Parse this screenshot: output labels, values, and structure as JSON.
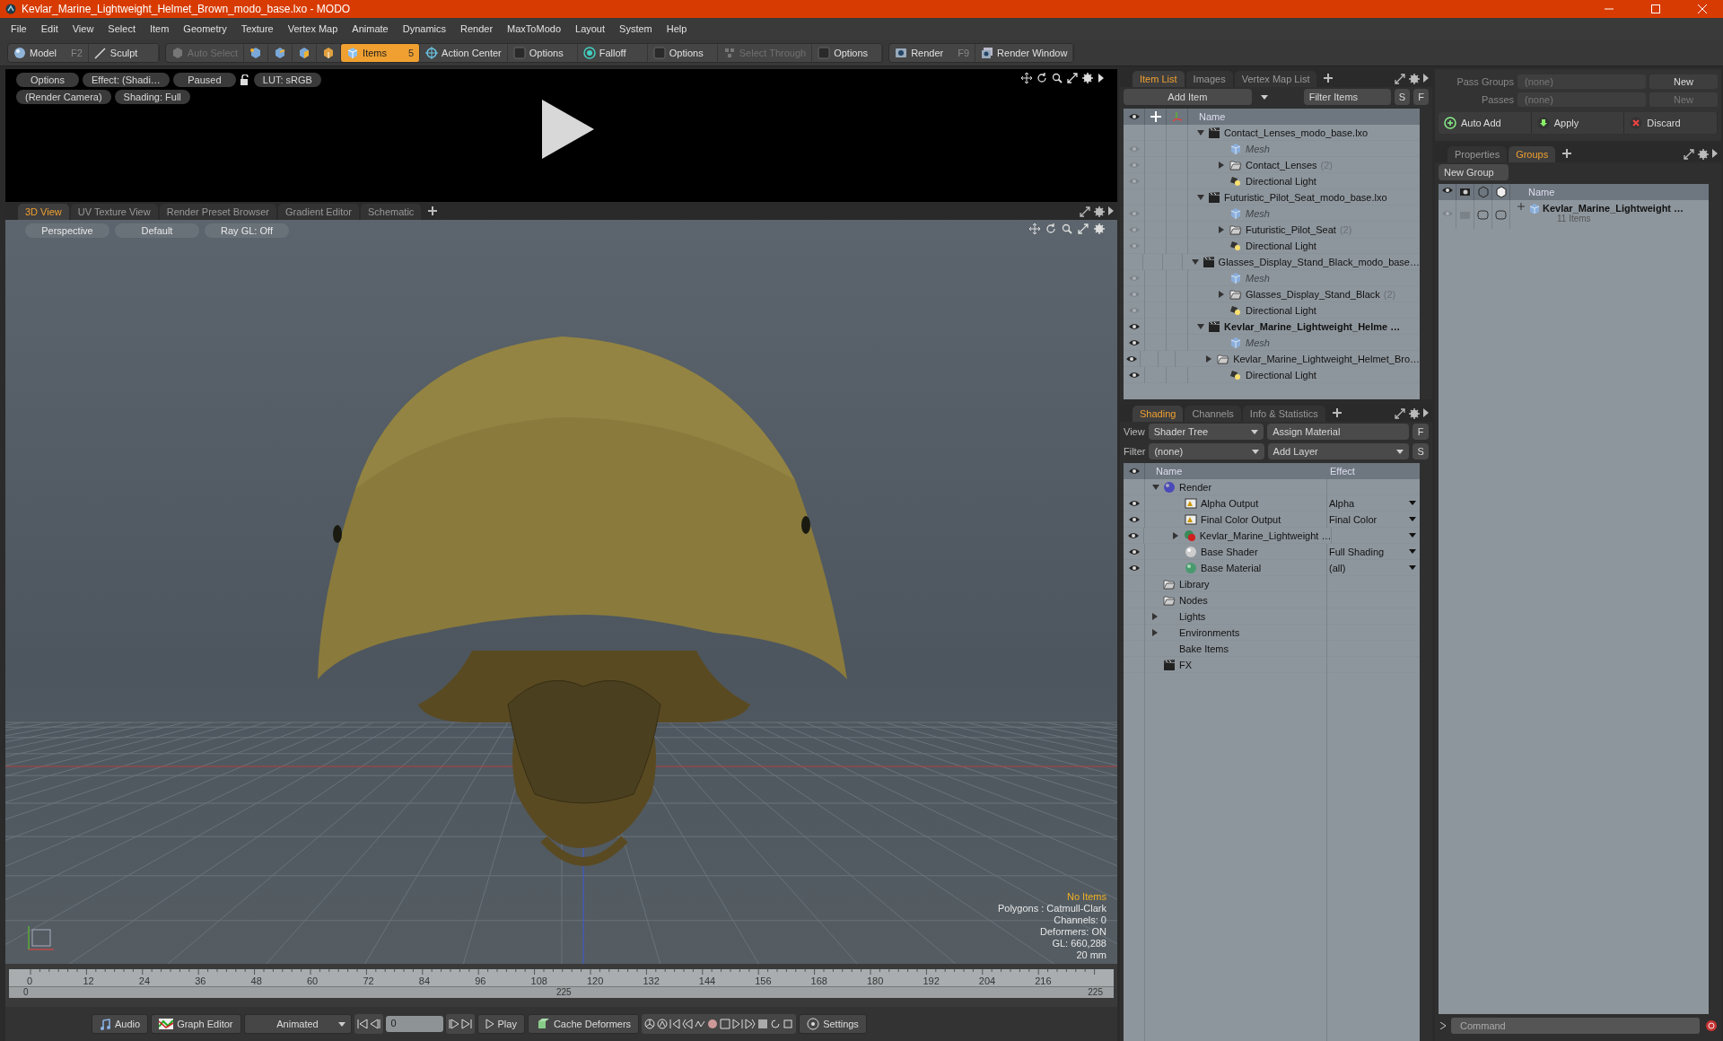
{
  "window": {
    "title": "Kevlar_Marine_Lightweight_Helmet_Brown_modo_base.lxo - MODO"
  },
  "menu": [
    "File",
    "Edit",
    "View",
    "Select",
    "Item",
    "Geometry",
    "Texture",
    "Vertex Map",
    "Animate",
    "Dynamics",
    "Render",
    "MaxToModo",
    "Layout",
    "System",
    "Help"
  ],
  "toolbar": [
    [
      {
        "kind": "model",
        "label": "Model",
        "shortcut": "F2",
        "selected": false,
        "disabled": false
      },
      {
        "kind": "sculpt",
        "label": "Sculpt",
        "selected": false,
        "disabled": false
      }
    ],
    [
      {
        "kind": "auto-select",
        "label": "Auto Select",
        "selected": false,
        "disabled": true
      },
      {
        "kind": "vertices",
        "selected": false
      },
      {
        "kind": "edges",
        "selected": false
      },
      {
        "kind": "polygons",
        "selected": false
      },
      {
        "kind": "materials",
        "selected": false
      },
      {
        "kind": "items",
        "label": "Items",
        "count": "5",
        "selected": true,
        "disabled": false
      },
      {
        "kind": "action-center",
        "label": "Action Center",
        "selected": false,
        "disabled": false
      },
      {
        "kind": "options",
        "label": "Options",
        "selected": false,
        "disabled": false
      },
      {
        "kind": "falloff",
        "label": "Falloff",
        "selected": false,
        "disabled": false
      },
      {
        "kind": "options",
        "label": "Options",
        "selected": false,
        "disabled": false
      },
      {
        "kind": "select-through",
        "label": "Select Through",
        "selected": false,
        "disabled": true
      },
      {
        "kind": "options",
        "label": "Options",
        "selected": false,
        "disabled": false
      }
    ],
    [
      {
        "kind": "render",
        "label": "Render",
        "shortcut": "F9",
        "selected": false,
        "disabled": false
      },
      {
        "kind": "render-window",
        "label": "Render Window",
        "selected": false,
        "disabled": false
      }
    ]
  ],
  "preview": {
    "rows": [
      [
        {
          "kind": "button",
          "label": "Options"
        },
        {
          "kind": "button",
          "label": "Effect: (Shadi…"
        },
        {
          "kind": "button",
          "label": "Paused"
        },
        {
          "kind": "lock"
        },
        {
          "kind": "button",
          "label": "LUT: sRGB"
        }
      ],
      [
        {
          "kind": "button",
          "label": "(Render Camera)"
        },
        {
          "kind": "button",
          "label": "Shading: Full"
        }
      ]
    ]
  },
  "viewport_tabs": [
    {
      "label": "3D View",
      "selected": true
    },
    {
      "label": "UV Texture View",
      "selected": false
    },
    {
      "label": "Render Preset Browser",
      "selected": false
    },
    {
      "label": "Gradient Editor",
      "selected": false
    },
    {
      "label": "Schematic",
      "selected": false
    }
  ],
  "viewport": {
    "buttons": [
      "Perspective",
      "Default",
      "Ray GL: Off"
    ],
    "stats": [
      {
        "text": "No Items",
        "kind": "warning"
      },
      {
        "text": "Polygons : Catmull-Clark",
        "kind": "info"
      },
      {
        "text": "Channels: 0",
        "kind": "info"
      },
      {
        "text": "Deformers: ON",
        "kind": "info"
      },
      {
        "text": "GL: 660,288",
        "kind": "info"
      },
      {
        "text": "20 mm",
        "kind": "info"
      }
    ]
  },
  "timeline": {
    "ticks": [
      "0",
      "12",
      "24",
      "36",
      "48",
      "60",
      "72",
      "84",
      "96",
      "108",
      "120",
      "132",
      "144",
      "156",
      "168",
      "180",
      "192",
      "204",
      "216"
    ],
    "start": "0",
    "middle": "225",
    "end": "225"
  },
  "bottom_bar": [
    {
      "kind": "button",
      "label": "Audio"
    },
    {
      "kind": "button",
      "label": "Graph Editor"
    },
    {
      "kind": "dropdown",
      "label": "Animated"
    },
    {
      "kind": "transport-back"
    },
    {
      "kind": "frame",
      "value": "0"
    },
    {
      "kind": "transport-forward"
    },
    {
      "kind": "button",
      "label": "Play"
    },
    {
      "kind": "button",
      "label": "Cache Deformers"
    },
    {
      "kind": "tools"
    },
    {
      "kind": "button",
      "label": "Settings"
    }
  ],
  "item_list": {
    "tabs": [
      {
        "label": "Item List",
        "selected": true
      },
      {
        "label": "Images",
        "selected": false
      },
      {
        "label": "Vertex Map List",
        "selected": false
      }
    ],
    "add_item": "Add Item",
    "filter": "Filter Items",
    "buttons": [
      "S",
      "F"
    ],
    "column": "Name",
    "items": [
      {
        "kind": "scene",
        "name": "Contact_Lenses_modo_base.lxo",
        "current": false,
        "visible": false,
        "expanded": true,
        "children": [
          {
            "kind": "mesh",
            "name": "Mesh",
            "visible": false
          },
          {
            "kind": "group",
            "name": "Contact_Lenses",
            "count": "(2)",
            "visible": false,
            "expanded": false
          },
          {
            "kind": "light",
            "name": "Directional Light",
            "visible": false
          }
        ]
      },
      {
        "kind": "scene",
        "name": "Futuristic_Pilot_Seat_modo_base.lxo",
        "current": false,
        "visible": false,
        "expanded": true,
        "children": [
          {
            "kind": "mesh",
            "name": "Mesh",
            "visible": false
          },
          {
            "kind": "group",
            "name": "Futuristic_Pilot_Seat",
            "count": "(2)",
            "visible": false,
            "expanded": false
          },
          {
            "kind": "light",
            "name": "Directional Light",
            "visible": false
          }
        ]
      },
      {
        "kind": "scene",
        "name": "Glasses_Display_Stand_Black_modo_base…",
        "current": false,
        "visible": false,
        "expanded": true,
        "children": [
          {
            "kind": "mesh",
            "name": "Mesh",
            "visible": false
          },
          {
            "kind": "group",
            "name": "Glasses_Display_Stand_Black",
            "count": "(2)",
            "visible": false,
            "expanded": false
          },
          {
            "kind": "light",
            "name": "Directional Light",
            "visible": false
          }
        ]
      },
      {
        "kind": "scene",
        "name": "Kevlar_Marine_Lightweight_Helme …",
        "current": true,
        "visible": true,
        "expanded": true,
        "children": [
          {
            "kind": "mesh",
            "name": "Mesh",
            "visible": true
          },
          {
            "kind": "group",
            "name": "Kevlar_Marine_Lightweight_Helmet_Bro…",
            "visible": true,
            "expanded": false
          },
          {
            "kind": "light",
            "name": "Directional Light",
            "visible": true
          }
        ]
      }
    ]
  },
  "shading": {
    "tabs": [
      {
        "label": "Shading",
        "selected": true
      },
      {
        "label": "Channels",
        "selected": false
      },
      {
        "label": "Info & Statistics",
        "selected": false
      }
    ],
    "view_label": "View",
    "view": "Shader Tree",
    "assign": "Assign Material",
    "assign_key": "F",
    "filter_label": "Filter",
    "filter": "(none)",
    "add_layer": "Add Layer",
    "add_key": "S",
    "columns": [
      "Name",
      "Effect"
    ],
    "items": [
      {
        "kind": "render",
        "name": "Render",
        "expanded": true,
        "children": [
          {
            "kind": "output",
            "name": "Alpha Output",
            "effect": "Alpha",
            "visible": true
          },
          {
            "kind": "output",
            "name": "Final Color Output",
            "effect": "Final Color",
            "visible": true
          },
          {
            "kind": "material-group",
            "name": "Kevlar_Marine_Lightweight …",
            "visible": true,
            "expanded": false
          },
          {
            "kind": "shader",
            "name": "Base Shader",
            "effect": "Full Shading",
            "visible": true
          },
          {
            "kind": "material",
            "name": "Base Material",
            "effect": "(all)",
            "visible": true
          }
        ]
      },
      {
        "kind": "folder",
        "name": "Library"
      },
      {
        "kind": "folder",
        "name": "Nodes"
      },
      {
        "kind": "branch",
        "name": "Lights",
        "expanded": false
      },
      {
        "kind": "branch",
        "name": "Environments",
        "expanded": false
      },
      {
        "kind": "plain",
        "name": "Bake Items"
      },
      {
        "kind": "fx",
        "name": "FX"
      }
    ]
  },
  "passes": {
    "rows": [
      {
        "label": "Pass Groups",
        "value": "(none)",
        "button": "New",
        "disabled": false
      },
      {
        "label": "Passes",
        "value": "(none)",
        "button": "New",
        "disabled": true
      }
    ],
    "actions": [
      {
        "kind": "auto-add",
        "label": "Auto Add"
      },
      {
        "kind": "apply",
        "label": "Apply"
      },
      {
        "kind": "discard",
        "label": "Discard"
      }
    ]
  },
  "groups_panel": {
    "tabs": [
      {
        "label": "Properties",
        "selected": false
      },
      {
        "label": "Groups",
        "selected": true
      }
    ],
    "new_group": "New Group",
    "column": "Name",
    "groups": [
      {
        "name": "Kevlar_Marine_Lightweight …",
        "count": "11 Items"
      }
    ]
  },
  "command": {
    "placeholder": "Command"
  }
}
